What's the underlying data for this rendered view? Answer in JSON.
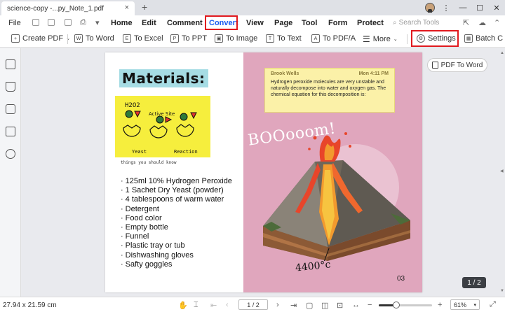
{
  "window": {
    "tab_title": "science-copy -...py_Note_1.pdf",
    "tab_close": "×",
    "new_tab": "+",
    "minimize": "—",
    "maximize": "☐",
    "close": "✕"
  },
  "menu": {
    "file": "File",
    "items": [
      "Home",
      "Edit",
      "Comment",
      "Convert",
      "View",
      "Page",
      "Tool",
      "Form",
      "Protect"
    ],
    "active": "Convert",
    "search_placeholder": "Search Tools"
  },
  "toolbar": {
    "create_pdf": "Create PDF",
    "to_word": "To Word",
    "to_excel": "To Excel",
    "to_ppt": "To PPT",
    "to_image": "To Image",
    "to_text": "To Text",
    "to_pdfa": "To PDF/A",
    "more": "More",
    "settings": "Settings",
    "batch": "Batch C"
  },
  "document": {
    "materials_title": "Materials:",
    "yeast_labels": {
      "h2o2": "H2O2",
      "active_site": "Active Site",
      "yeast": "Yeast",
      "reaction": "Reaction"
    },
    "caption": "things you should know",
    "items": [
      "125ml 10% Hydrogen Peroxide",
      "1 Sachet Dry Yeast (powder)",
      "4 tablespoons of warm water",
      "Detergent",
      "Food color",
      "Empty bottle",
      "Funnel",
      "Plastic tray or tub",
      "Dishwashing gloves",
      "Safty goggles"
    ],
    "note": {
      "author": "Brook Wells",
      "time": "Mon 4:11 PM",
      "text": "Hydrogen peroxide molecules are very unstable and naturally decompose into water and oxygen gas. The chemical equation for this decomposition is:"
    },
    "boom_text": "BOOooom!",
    "temperature": "4400°c",
    "page_number": "03"
  },
  "floating": {
    "pdf_to_word": "PDF To Word",
    "page_indicator": "1 / 2"
  },
  "status": {
    "dimensions": "27.94 x 21.59 cm",
    "page_field": "1 / 2",
    "zoom": "61%",
    "zoom_level": 0.33
  },
  "colors": {
    "accent": "#1a5cf0",
    "highlight": "#e1191e",
    "page_right_bg": "#e0a6bd",
    "note_bg": "#fbf1a8"
  }
}
